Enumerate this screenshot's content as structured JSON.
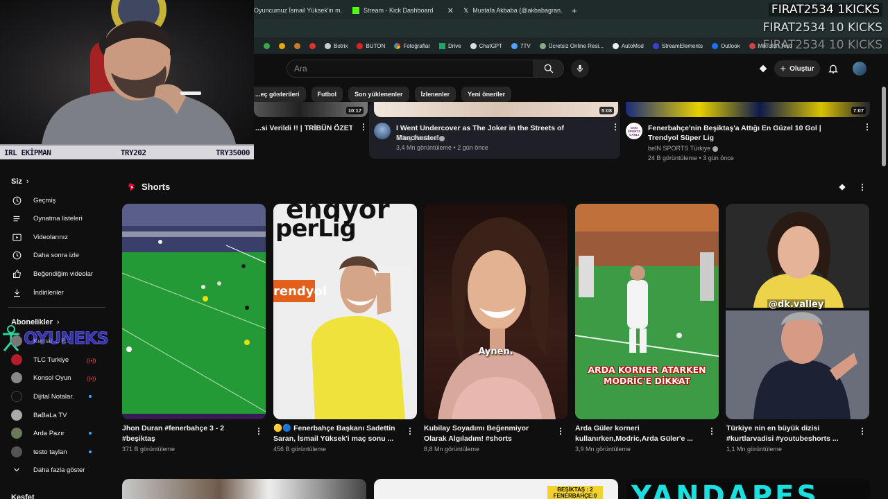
{
  "tabs": [
    {
      "label": "Oyuncumuz İsmail Yüksek'in m..."
    },
    {
      "label": "Stream - Kick Dashboard"
    },
    {
      "label": "Mustafa Akbaba (@akbabagran..."
    }
  ],
  "bookmarks": [
    "Botrix",
    "BUTON",
    "Fotoğraflar",
    "Drive",
    "ChatGPT",
    "7TV",
    "Ücretsiz Online Resi...",
    "AutoMod",
    "StreamElements",
    "Outlook",
    "Mikrofon Testi"
  ],
  "kicks_overlay": [
    "FIRAT2534  1KICKS",
    "FIRAT2534  10 KICKS",
    "FIRAT2534  10 KICKS"
  ],
  "webcam_bar": {
    "left": "IRL EKİPMAN",
    "center": "TRY202",
    "right": "TRY35000"
  },
  "header": {
    "search_placeholder": "Ara",
    "create_label": "Oluştur"
  },
  "chips": [
    "...eç gösterileri",
    "Futbol",
    "Son yüklenenler",
    "İzlenenler",
    "Yeni öneriler"
  ],
  "top_videos": [
    {
      "title": "...si Verildi !! | TRİBÜN ÖZETİ",
      "duration": "10:17"
    },
    {
      "title": "I Went Undercover as The Joker in the Streets of Manchester!",
      "channel": "Erling Haaland",
      "meta": "3,4 Mn görüntüleme • 2 gün önce",
      "duration": "5:08"
    },
    {
      "title": "Fenerbahçe'nin Beşiktaş'a Attığı En Güzel 10 Gol | Trendyol Süper Lig",
      "channel": "beIN SPORTS Türkiye",
      "meta": "24 B görüntüleme • 3 gün önce",
      "duration": "7:07",
      "avatar_text": "beIN SPORTS CANLI"
    }
  ],
  "sidebar": {
    "you_label": "Siz",
    "items": [
      "Geçmiş",
      "Oynatma listeleri",
      "Videolarınız",
      "Daha sonra izle",
      "Beğendiğim videolar",
      "İndirilenler"
    ],
    "subs_label": "Abonelikler",
    "subs": [
      "Kemal ... F...",
      "TLC Turkiye",
      "Konsol Oyun",
      "Dijital Notalar.",
      "BaBaLa TV",
      "Arda Pazır",
      "testo taylan"
    ],
    "show_more": "Daha fazla göster",
    "next_section": "Keşfet",
    "watermark": "OYUNEKS"
  },
  "shorts": {
    "title": "Shorts",
    "items": [
      {
        "title": "Jhon Duran #fenerbahçe 3 - 2 #beşiktaş",
        "views": "371 B görüntüleme"
      },
      {
        "title": "🟡🔵 Fenerbahçe Başkanı Sadettin Saran, İsmail Yüksek'i maç sonu ...",
        "views": "456 B görüntüleme",
        "overlay": "perLig",
        "overlay_top": "ehdyor",
        "side_text": "rendyol"
      },
      {
        "title": "Kubilay Soyadımı Beğenmiyor Olarak Algıladım! #shorts",
        "views": "8,8 Mn görüntüleme",
        "caption": "Aynen."
      },
      {
        "title": "Arda Güler korneri kullanırken,Modric,Arda Güler'e ...",
        "views": "3,9 Mn görüntüleme",
        "caption_line1": "ARDA KORNER ATARKEN",
        "caption_line2": "MODRİC'E DİKKAT"
      },
      {
        "title": "Türkiye nin en büyük dizisi #kurtlarvadisi #youtubeshorts ...",
        "views": "1,1 Mn görüntüleme",
        "caption": "@dk.valley"
      }
    ]
  },
  "bottom_row": {
    "badge_line1": "BEŞİKTAŞ : 2",
    "badge_line2": "FENERBAHÇE:0",
    "big_text": "YANDAPES"
  }
}
